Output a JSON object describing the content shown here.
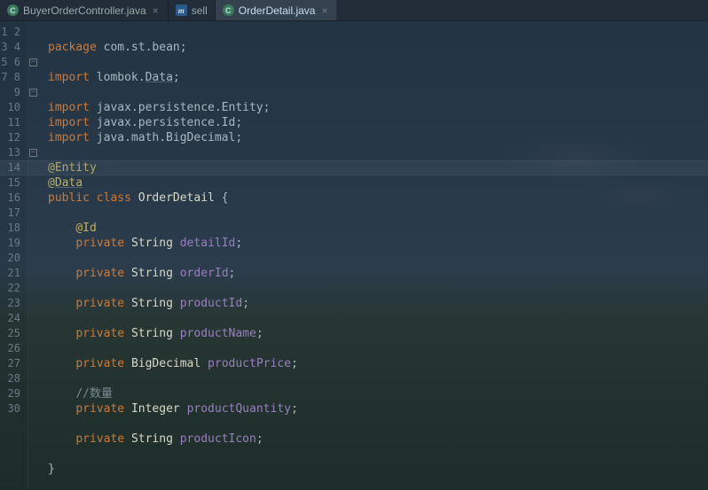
{
  "tabs": [
    {
      "icon": "C",
      "iconType": "class",
      "label": "BuyerOrderController.java",
      "active": false
    },
    {
      "icon": "m",
      "iconType": "maven",
      "label": "sell",
      "active": false
    },
    {
      "icon": "C",
      "iconType": "class",
      "label": "OrderDetail.java",
      "active": true
    }
  ],
  "highlightLine": 10,
  "folds": [
    3,
    5,
    9
  ],
  "gutterStart": 1,
  "gutterEnd": 30,
  "code": {
    "l1": {
      "kw": "package",
      "rest": " com.st.bean;"
    },
    "l3": {
      "kw": "import",
      "mid": " lombok.",
      "data": "Data",
      "end": ";"
    },
    "l5": {
      "kw": "import",
      "rest": " javax.persistence.Entity;"
    },
    "l6": {
      "kw": "import",
      "rest": " javax.persistence.Id;"
    },
    "l7": {
      "kw": "import",
      "rest": " java.math.BigDecimal;"
    },
    "l9": "@Entity",
    "l10": "@Data",
    "l11": {
      "pub": "public",
      "cls": "class",
      "name": "OrderDetail",
      "brace": " {"
    },
    "l13": "@Id",
    "l14": {
      "pv": "private",
      "ty": "String",
      "fd": "detailId",
      "sc": ";"
    },
    "l16": {
      "pv": "private",
      "ty": "String",
      "fd": "orderId",
      "sc": ";"
    },
    "l18": {
      "pv": "private",
      "ty": "String",
      "fd": "productId",
      "sc": ";"
    },
    "l20": {
      "pv": "private",
      "ty": "String",
      "fd": "productName",
      "sc": ";"
    },
    "l22": {
      "pv": "private",
      "ty": "BigDecimal",
      "fd": "productPrice",
      "sc": ";"
    },
    "l24": "//数量",
    "l25": {
      "pv": "private",
      "ty": "Integer",
      "fd": "productQuantity",
      "sc": ";"
    },
    "l27": {
      "pv": "private",
      "ty": "String",
      "fd": "productIcon",
      "sc": ";"
    },
    "l29": "}"
  }
}
